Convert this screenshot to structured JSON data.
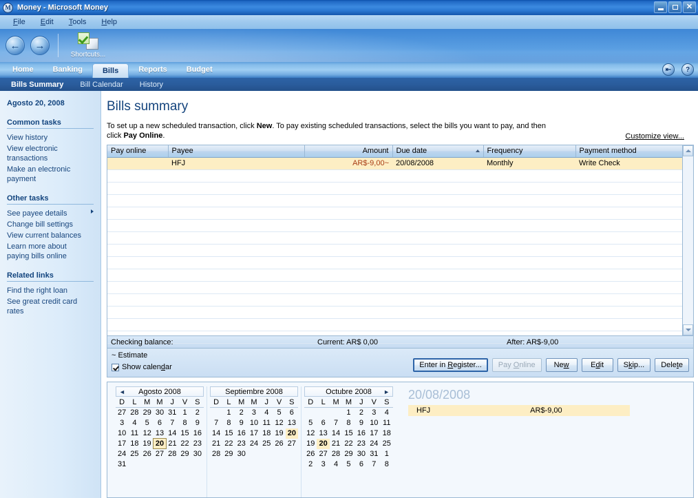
{
  "window": {
    "title": "Money - Microsoft Money",
    "app_icon": "M",
    "minimize_label": "Minimize",
    "restore_label": "Restore",
    "close_label": "Close"
  },
  "menu": [
    {
      "label": "File",
      "accel": "F"
    },
    {
      "label": "Edit",
      "accel": "E"
    },
    {
      "label": "Tools",
      "accel": "T"
    },
    {
      "label": "Help",
      "accel": "H"
    }
  ],
  "toolbar": {
    "back_icon": "back-arrow-icon",
    "forward_icon": "forward-arrow-icon",
    "shortcuts_label": "Shortcuts...",
    "shortcuts_icon": "shortcuts-checkmark-icon"
  },
  "tabs": [
    {
      "label": "Home",
      "active": false
    },
    {
      "label": "Banking",
      "active": false
    },
    {
      "label": "Bills",
      "active": true
    },
    {
      "label": "Reports",
      "active": false
    },
    {
      "label": "Budget",
      "active": false
    }
  ],
  "tab_icons": [
    {
      "name": "sync-icon",
      "glyph": "⇤"
    },
    {
      "name": "help-icon",
      "glyph": "?"
    }
  ],
  "subtabs": [
    {
      "label": "Bills Summary",
      "active": true
    },
    {
      "label": "Bill Calendar",
      "active": false
    },
    {
      "label": "History",
      "active": false
    }
  ],
  "sidebar": {
    "date": "Agosto 20, 2008",
    "groups": [
      {
        "title": "Common tasks",
        "items": [
          {
            "label": "View history",
            "submenu": false
          },
          {
            "label": "View electronic transactions",
            "submenu": false
          },
          {
            "label": "Make an electronic payment",
            "submenu": false
          }
        ]
      },
      {
        "title": "Other tasks",
        "items": [
          {
            "label": "See payee details",
            "submenu": true
          },
          {
            "label": "Change bill settings",
            "submenu": false
          },
          {
            "label": "View current balances",
            "submenu": false
          },
          {
            "label": "Learn more about paying bills online",
            "submenu": false
          }
        ]
      },
      {
        "title": "Related links",
        "items": [
          {
            "label": "Find the right loan",
            "submenu": false
          },
          {
            "label": "See great credit card rates",
            "submenu": false
          }
        ]
      }
    ]
  },
  "main": {
    "page_title": "Bills summary",
    "intro_part1": "To set up a new scheduled transaction, click ",
    "intro_bold1": "New",
    "intro_part2": ". To pay existing scheduled transactions, select the bills you want to pay, and then click ",
    "intro_bold2": "Pay Online",
    "intro_part3": ".",
    "customize_link": "Customize view..."
  },
  "table": {
    "columns": [
      {
        "label": "Pay online",
        "align": "left"
      },
      {
        "label": "Payee",
        "align": "left"
      },
      {
        "label": "Amount",
        "align": "right"
      },
      {
        "label": "Due date",
        "align": "left",
        "sorted": "asc"
      },
      {
        "label": "Frequency",
        "align": "left"
      },
      {
        "label": "Payment method",
        "align": "left"
      }
    ],
    "rows": [
      {
        "pay_online": "",
        "payee": "HFJ",
        "amount": "AR$-9,00~",
        "due_date": "20/08/2008",
        "frequency": "Monthly",
        "payment_method": "Write Check",
        "selected": true
      }
    ],
    "empty_row_count": 14
  },
  "balance": {
    "label": "Checking balance:",
    "current": "Current: AR$ 0,00",
    "after": "After: AR$-9,00"
  },
  "actions": {
    "estimate_note": "~ Estimate",
    "show_calendar_label": "Show calendar",
    "show_calendar_checked": true,
    "buttons": [
      {
        "label": "Enter in Register...",
        "accel": "R",
        "default": true,
        "disabled": false
      },
      {
        "label": "Pay Online",
        "accel": "O",
        "default": false,
        "disabled": true
      },
      {
        "label": "New",
        "accel": "w",
        "default": false,
        "disabled": false
      },
      {
        "label": "Edit",
        "accel": "d",
        "default": false,
        "disabled": false
      },
      {
        "label": "Skip...",
        "accel": "k",
        "default": false,
        "disabled": false
      },
      {
        "label": "Delete",
        "accel": "t",
        "default": false,
        "disabled": false
      }
    ]
  },
  "calendar": {
    "day_headers": [
      "D",
      "L",
      "M",
      "M",
      "J",
      "V",
      "S"
    ],
    "prev_arrow": "◄",
    "next_arrow": "►",
    "months": [
      {
        "title": "Agosto 2008",
        "has_prev": true,
        "has_next": false,
        "weeks": [
          [
            {
              "d": "27",
              "s": "dim"
            },
            {
              "d": "28",
              "s": "dim"
            },
            {
              "d": "29",
              "s": "dim"
            },
            {
              "d": "30",
              "s": "dim"
            },
            {
              "d": "31",
              "s": "dim"
            },
            {
              "d": "1",
              "s": "dim"
            },
            {
              "d": "2",
              "s": "dim"
            }
          ],
          [
            {
              "d": "3",
              "s": "dim"
            },
            {
              "d": "4",
              "s": "dim"
            },
            {
              "d": "5",
              "s": "dim"
            },
            {
              "d": "6",
              "s": "dim"
            },
            {
              "d": "7",
              "s": "dim"
            },
            {
              "d": "8",
              "s": "dim"
            },
            {
              "d": "9",
              "s": "dim"
            }
          ],
          [
            {
              "d": "10",
              "s": "dim"
            },
            {
              "d": "11",
              "s": "dim"
            },
            {
              "d": "12",
              "s": "dim"
            },
            {
              "d": "13",
              "s": "dim"
            },
            {
              "d": "14",
              "s": "dim"
            },
            {
              "d": "15",
              "s": "dim"
            },
            {
              "d": "16",
              "s": "dim"
            }
          ],
          [
            {
              "d": "17",
              "s": "dim"
            },
            {
              "d": "18",
              "s": "dim"
            },
            {
              "d": "19",
              "s": "dim"
            },
            {
              "d": "20",
              "s": "today"
            },
            {
              "d": "21",
              "s": ""
            },
            {
              "d": "22",
              "s": ""
            },
            {
              "d": "23",
              "s": ""
            }
          ],
          [
            {
              "d": "24",
              "s": ""
            },
            {
              "d": "25",
              "s": ""
            },
            {
              "d": "26",
              "s": ""
            },
            {
              "d": "27",
              "s": ""
            },
            {
              "d": "28",
              "s": ""
            },
            {
              "d": "29",
              "s": ""
            },
            {
              "d": "30",
              "s": ""
            }
          ],
          [
            {
              "d": "31",
              "s": ""
            },
            {
              "d": "",
              "s": ""
            },
            {
              "d": "",
              "s": ""
            },
            {
              "d": "",
              "s": ""
            },
            {
              "d": "",
              "s": ""
            },
            {
              "d": "",
              "s": ""
            },
            {
              "d": "",
              "s": ""
            }
          ]
        ]
      },
      {
        "title": "Septiembre 2008",
        "has_prev": false,
        "has_next": false,
        "weeks": [
          [
            {
              "d": "",
              "s": ""
            },
            {
              "d": "1",
              "s": ""
            },
            {
              "d": "2",
              "s": ""
            },
            {
              "d": "3",
              "s": ""
            },
            {
              "d": "4",
              "s": ""
            },
            {
              "d": "5",
              "s": ""
            },
            {
              "d": "6",
              "s": ""
            }
          ],
          [
            {
              "d": "7",
              "s": ""
            },
            {
              "d": "8",
              "s": ""
            },
            {
              "d": "9",
              "s": ""
            },
            {
              "d": "10",
              "s": ""
            },
            {
              "d": "11",
              "s": ""
            },
            {
              "d": "12",
              "s": ""
            },
            {
              "d": "13",
              "s": ""
            }
          ],
          [
            {
              "d": "14",
              "s": ""
            },
            {
              "d": "15",
              "s": ""
            },
            {
              "d": "16",
              "s": ""
            },
            {
              "d": "17",
              "s": ""
            },
            {
              "d": "18",
              "s": ""
            },
            {
              "d": "19",
              "s": ""
            },
            {
              "d": "20",
              "s": "mark"
            }
          ],
          [
            {
              "d": "21",
              "s": ""
            },
            {
              "d": "22",
              "s": ""
            },
            {
              "d": "23",
              "s": ""
            },
            {
              "d": "24",
              "s": ""
            },
            {
              "d": "25",
              "s": ""
            },
            {
              "d": "26",
              "s": ""
            },
            {
              "d": "27",
              "s": ""
            }
          ],
          [
            {
              "d": "28",
              "s": ""
            },
            {
              "d": "29",
              "s": ""
            },
            {
              "d": "30",
              "s": ""
            },
            {
              "d": "",
              "s": ""
            },
            {
              "d": "",
              "s": ""
            },
            {
              "d": "",
              "s": ""
            },
            {
              "d": "",
              "s": ""
            }
          ],
          [
            {
              "d": "",
              "s": ""
            },
            {
              "d": "",
              "s": ""
            },
            {
              "d": "",
              "s": ""
            },
            {
              "d": "",
              "s": ""
            },
            {
              "d": "",
              "s": ""
            },
            {
              "d": "",
              "s": ""
            },
            {
              "d": "",
              "s": ""
            }
          ]
        ]
      },
      {
        "title": "Octubre 2008",
        "has_prev": false,
        "has_next": true,
        "weeks": [
          [
            {
              "d": "",
              "s": ""
            },
            {
              "d": "",
              "s": ""
            },
            {
              "d": "",
              "s": ""
            },
            {
              "d": "1",
              "s": ""
            },
            {
              "d": "2",
              "s": ""
            },
            {
              "d": "3",
              "s": ""
            },
            {
              "d": "4",
              "s": ""
            }
          ],
          [
            {
              "d": "5",
              "s": ""
            },
            {
              "d": "6",
              "s": ""
            },
            {
              "d": "7",
              "s": ""
            },
            {
              "d": "8",
              "s": ""
            },
            {
              "d": "9",
              "s": ""
            },
            {
              "d": "10",
              "s": ""
            },
            {
              "d": "11",
              "s": ""
            }
          ],
          [
            {
              "d": "12",
              "s": ""
            },
            {
              "d": "13",
              "s": ""
            },
            {
              "d": "14",
              "s": ""
            },
            {
              "d": "15",
              "s": ""
            },
            {
              "d": "16",
              "s": ""
            },
            {
              "d": "17",
              "s": ""
            },
            {
              "d": "18",
              "s": ""
            }
          ],
          [
            {
              "d": "19",
              "s": ""
            },
            {
              "d": "20",
              "s": "mark"
            },
            {
              "d": "21",
              "s": ""
            },
            {
              "d": "22",
              "s": ""
            },
            {
              "d": "23",
              "s": ""
            },
            {
              "d": "24",
              "s": ""
            },
            {
              "d": "25",
              "s": ""
            }
          ],
          [
            {
              "d": "26",
              "s": ""
            },
            {
              "d": "27",
              "s": ""
            },
            {
              "d": "28",
              "s": ""
            },
            {
              "d": "29",
              "s": ""
            },
            {
              "d": "30",
              "s": ""
            },
            {
              "d": "31",
              "s": ""
            },
            {
              "d": "1",
              "s": "dim"
            }
          ],
          [
            {
              "d": "2",
              "s": "dim"
            },
            {
              "d": "3",
              "s": "dim"
            },
            {
              "d": "4",
              "s": "dim"
            },
            {
              "d": "5",
              "s": "dim"
            },
            {
              "d": "6",
              "s": "dim"
            },
            {
              "d": "7",
              "s": "dim"
            },
            {
              "d": "8",
              "s": "dim"
            }
          ]
        ]
      }
    ],
    "detail": {
      "date": "20/08/2008",
      "entries": [
        {
          "payee": "HFJ",
          "amount": "AR$-9,00"
        }
      ]
    }
  },
  "colors": {
    "accent": "#2d64a8",
    "selection": "#fdeec4",
    "amount_negative": "#a83c14",
    "title_blue": "#14447d"
  }
}
